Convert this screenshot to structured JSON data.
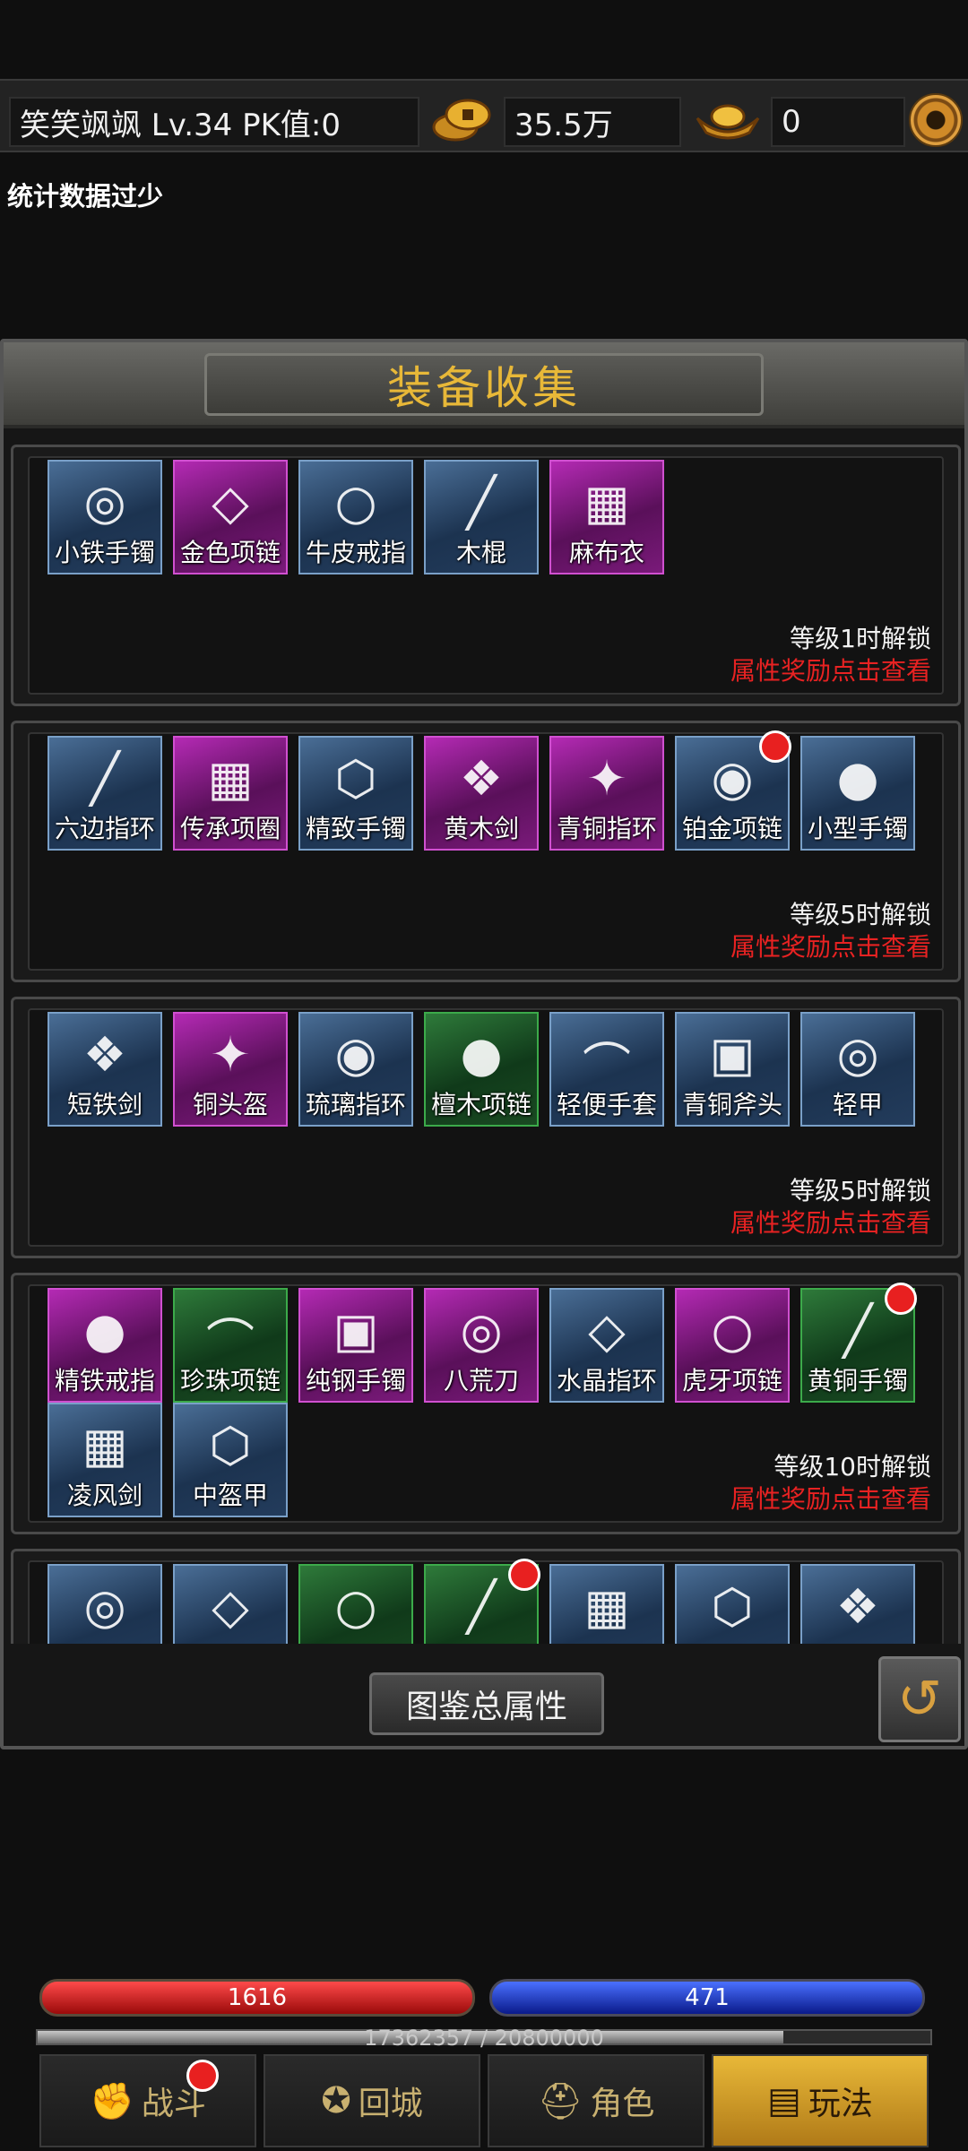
{
  "header": {
    "player": "笑笑飒飒  Lv.34 PK值:0",
    "gold": "35.5万",
    "ingot": "0",
    "icons": {
      "gold": "gold-coins-icon",
      "ingot": "gold-ingot-icon",
      "settings": "gear-icon"
    }
  },
  "notice": "统计数据过少",
  "panel": {
    "title": "装备收集",
    "reward_label": "属性奖励点击查看",
    "groups": [
      {
        "unlock": "等级1时解锁",
        "items": [
          {
            "name": "小铁手镯",
            "quality": "blue"
          },
          {
            "name": "金色项链",
            "quality": "purple"
          },
          {
            "name": "牛皮戒指",
            "quality": "blue"
          },
          {
            "name": "木棍",
            "quality": "blue"
          },
          {
            "name": "麻布衣",
            "quality": "purple"
          }
        ]
      },
      {
        "unlock": "等级5时解锁",
        "items": [
          {
            "name": "六边指环",
            "quality": "blue"
          },
          {
            "name": "传承项圈",
            "quality": "purple"
          },
          {
            "name": "精致手镯",
            "quality": "blue"
          },
          {
            "name": "黄木剑",
            "quality": "purple"
          },
          {
            "name": "青铜指环",
            "quality": "purple"
          },
          {
            "name": "铂金项链",
            "quality": "blue",
            "dot": true
          },
          {
            "name": "小型手镯",
            "quality": "blue"
          }
        ]
      },
      {
        "unlock": "等级5时解锁",
        "items": [
          {
            "name": "短铁剑",
            "quality": "blue"
          },
          {
            "name": "铜头盔",
            "quality": "purple"
          },
          {
            "name": "琉璃指环",
            "quality": "blue"
          },
          {
            "name": "檀木项链",
            "quality": "green"
          },
          {
            "name": "轻便手套",
            "quality": "blue"
          },
          {
            "name": "青铜斧头",
            "quality": "blue"
          },
          {
            "name": "轻甲",
            "quality": "blue"
          }
        ]
      },
      {
        "unlock": "等级10时解锁",
        "items": [
          {
            "name": "精铁戒指",
            "quality": "purple"
          },
          {
            "name": "珍珠项链",
            "quality": "green"
          },
          {
            "name": "纯钢手镯",
            "quality": "purple"
          },
          {
            "name": "八荒刀",
            "quality": "purple"
          },
          {
            "name": "水晶指环",
            "quality": "blue"
          },
          {
            "name": "虎牙项链",
            "quality": "purple"
          },
          {
            "name": "黄铜手镯",
            "quality": "green",
            "dot": true
          },
          {
            "name": "凌风剑",
            "quality": "blue"
          },
          {
            "name": "中盔甲",
            "quality": "blue"
          }
        ]
      },
      {
        "unlock": "",
        "items": [
          {
            "name": "",
            "quality": "blue"
          },
          {
            "name": "",
            "quality": "blue"
          },
          {
            "name": "",
            "quality": "green"
          },
          {
            "name": "",
            "quality": "green",
            "dot": true
          },
          {
            "name": "",
            "quality": "blue"
          },
          {
            "name": "",
            "quality": "blue"
          },
          {
            "name": "",
            "quality": "blue"
          }
        ]
      }
    ],
    "total_button": "图鉴总属性"
  },
  "hud": {
    "hp": "1616",
    "mp": "471",
    "exp_text": "17362357 / 20800000",
    "exp_fraction": 0.835
  },
  "nav": [
    {
      "label": "战斗",
      "icon": "fist-icon",
      "dot": true
    },
    {
      "label": "回城",
      "icon": "portal-icon"
    },
    {
      "label": "角色",
      "icon": "helmet-icon"
    },
    {
      "label": "玩法",
      "icon": "treasure-chest-icon",
      "active": true
    }
  ]
}
